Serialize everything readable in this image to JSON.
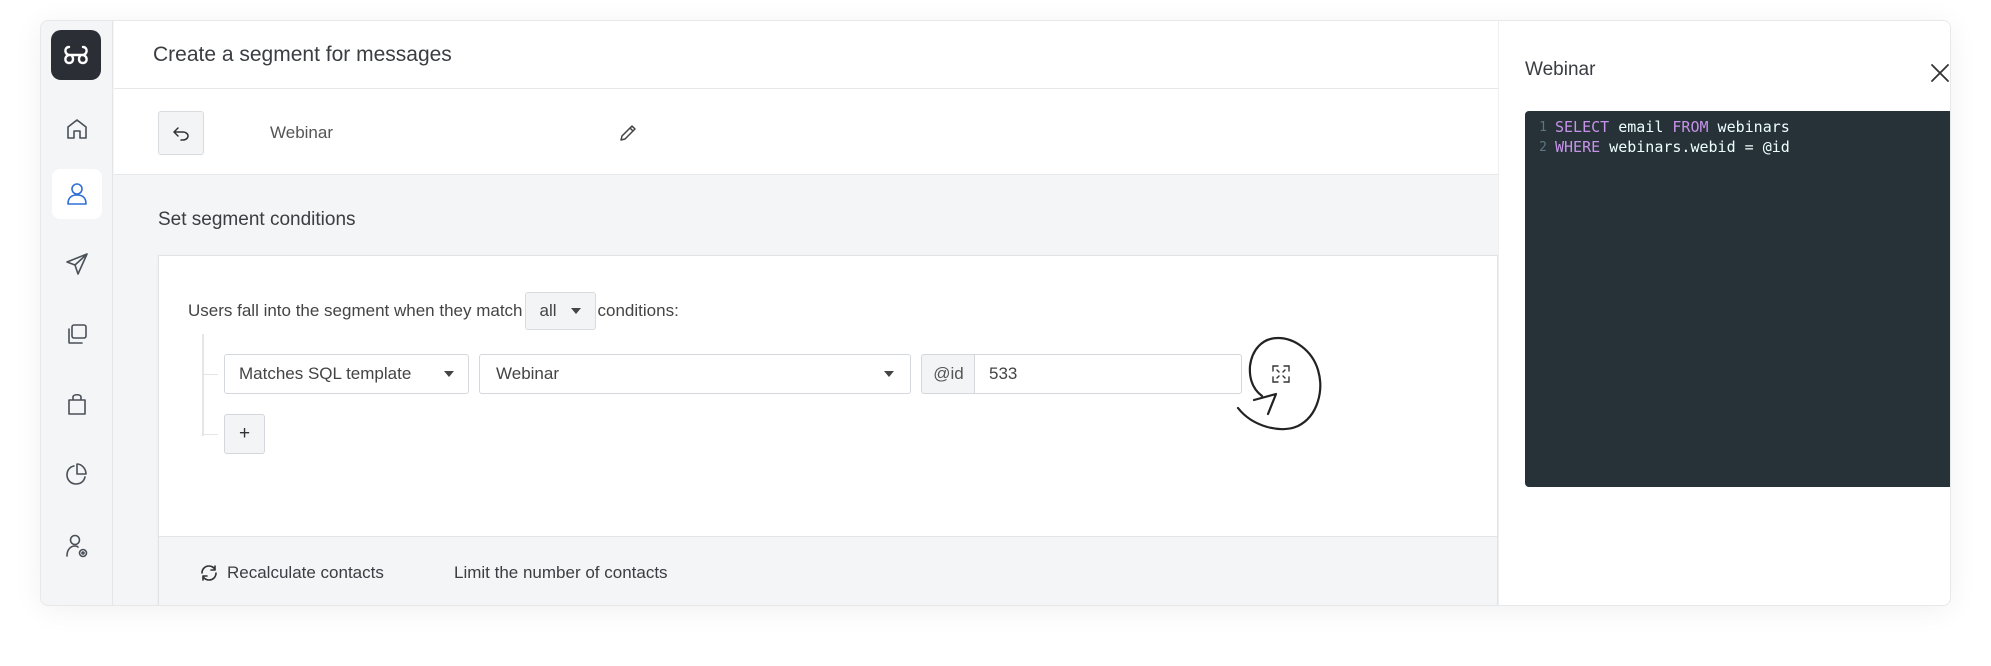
{
  "header": {
    "title": "Create a segment for messages"
  },
  "segment": {
    "name": "Webinar"
  },
  "sidebar": {
    "items": [
      {
        "icon": "home-icon"
      },
      {
        "icon": "user-icon",
        "active": true
      },
      {
        "icon": "send-icon"
      },
      {
        "icon": "copy-icon"
      },
      {
        "icon": "shopping-bag-icon"
      },
      {
        "icon": "pie-chart-icon"
      },
      {
        "icon": "user-settings-icon"
      }
    ]
  },
  "conditions": {
    "section_title": "Set segment conditions",
    "match_prefix": "Users fall into the segment when they match",
    "match_value": "all",
    "match_suffix": "conditions:",
    "row": {
      "type": "Matches SQL template",
      "template": "Webinar",
      "param_label": "@id",
      "param_value": "533"
    },
    "add_label": "+"
  },
  "footer": {
    "recalculate_label": "Recalculate contacts",
    "limit_label": "Limit the number of contacts"
  },
  "panel": {
    "title": "Webinar",
    "code": [
      {
        "num": "1",
        "parts": [
          [
            "kw",
            "SELECT"
          ],
          [
            "tx",
            " email "
          ],
          [
            "kw",
            "FROM"
          ],
          [
            "tx",
            " webinars"
          ]
        ]
      },
      {
        "num": "2",
        "parts": [
          [
            "kw",
            "WHERE"
          ],
          [
            "tx",
            " webinars.webid = @id"
          ]
        ]
      }
    ]
  },
  "colors": {
    "accent": "#2f6fd6",
    "code_bg": "#263238",
    "keyword": "#c792ea",
    "sidebar_logo": "#2b2f35"
  }
}
